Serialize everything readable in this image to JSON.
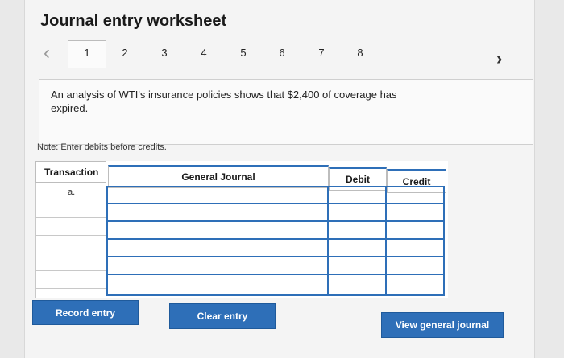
{
  "header": {
    "title": "Journal entry worksheet"
  },
  "tabs": [
    {
      "label": "1"
    },
    {
      "label": "2"
    },
    {
      "label": "3"
    },
    {
      "label": "4"
    },
    {
      "label": "5"
    },
    {
      "label": "6"
    },
    {
      "label": "7"
    },
    {
      "label": "8"
    }
  ],
  "question": {
    "text": "An analysis of WTI's insurance policies shows that $2,400 of coverage has expired."
  },
  "note": "Note: Enter debits before credits.",
  "table": {
    "headers": {
      "transaction": "Transaction",
      "general_journal": "General Journal",
      "debit": "Debit",
      "credit": "Credit"
    },
    "rows": [
      {
        "transaction": "a."
      },
      {
        "transaction": ""
      },
      {
        "transaction": ""
      },
      {
        "transaction": ""
      },
      {
        "transaction": ""
      },
      {
        "transaction": ""
      }
    ]
  },
  "buttons": {
    "record": "Record entry",
    "clear": "Clear entry",
    "view": "View general journal"
  },
  "colors": {
    "accent": "#2e6fb8"
  }
}
